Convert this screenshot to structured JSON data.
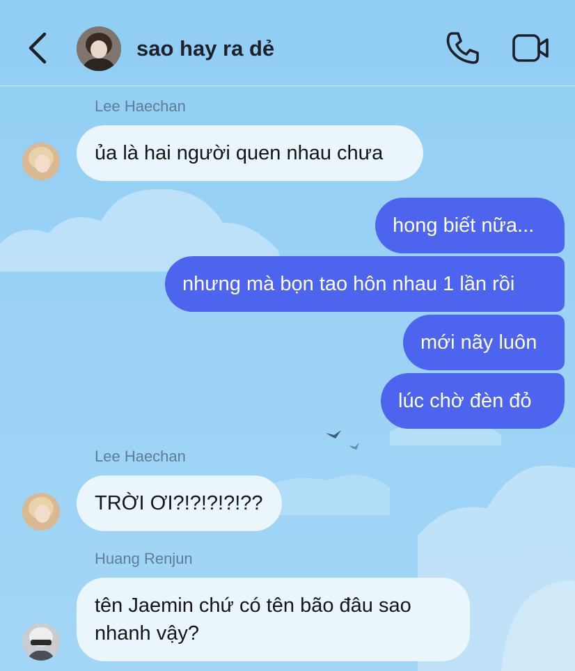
{
  "header": {
    "title": "sao hay ra dẻ",
    "back_icon": "chevron-left-icon",
    "call_icon": "phone-icon",
    "video_icon": "video-camera-icon"
  },
  "colors": {
    "background": "#94cff4",
    "incoming_bubble": "#eaf5fc",
    "outgoing_bubble": "#4d64ee",
    "sender_name": "#5f7d95"
  },
  "messages": [
    {
      "sender": "Lee Haechan",
      "text": "ủa là hai người quen nhau chưa",
      "direction": "incoming"
    },
    {
      "text": "hong biết nữa...",
      "direction": "outgoing"
    },
    {
      "text": "nhưng mà bọn tao hôn nhau 1 lần rồi",
      "direction": "outgoing"
    },
    {
      "text": "mới nãy luôn",
      "direction": "outgoing"
    },
    {
      "text": "lúc chờ đèn đỏ",
      "direction": "outgoing"
    },
    {
      "sender": "Lee Haechan",
      "text": "TRỜI ƠI?!?!?!?!??",
      "direction": "incoming"
    },
    {
      "sender": "Huang Renjun",
      "line1": "tên Jaemin chứ có tên bão đâu sao",
      "line2": "nhanh vậy?",
      "direction": "incoming"
    }
  ]
}
